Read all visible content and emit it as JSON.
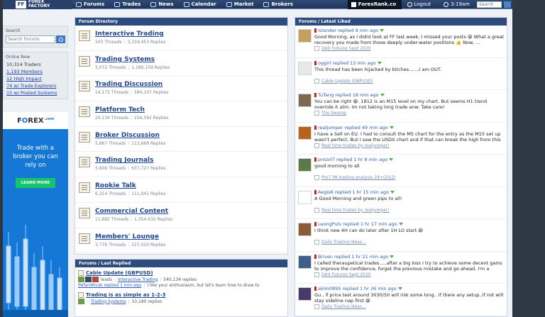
{
  "nav": {
    "logo_text": "FOREX FACTORY",
    "tabs": [
      "Forums",
      "Trades",
      "News",
      "Calendar",
      "Market",
      "Brokers"
    ],
    "forexrank": "ForexRank.co",
    "logout": "Logout",
    "time": "3:19am",
    "search_placeholder": "Search"
  },
  "sidebar": {
    "search_title": "Search",
    "search_placeholder": "Search Forums",
    "online_title": "Online Now",
    "online_items": [
      "10,314 Traders",
      "1,193 Members",
      "12 High Impact",
      "74 w/ Trade Explorers",
      "15 w/ Posted Systems"
    ],
    "ad": {
      "brand_a": "F",
      "brand_o": "O",
      "brand_b": "REX",
      "brand_dot": ".com",
      "text": "Trade with a broker you can rely on",
      "button": "LEARN MORE"
    }
  },
  "forum_directory": {
    "title": "Forum Directory",
    "forums": [
      {
        "name": "Interactive Trading",
        "threads": "503 Threads",
        "replies": "3,334,453 Replies"
      },
      {
        "name": "Trading Systems",
        "threads": "3,072 Threads",
        "replies": "1,186,159 Replies"
      },
      {
        "name": "Trading Discussion",
        "threads": "14,172 Threads",
        "replies": "584,107 Replies"
      },
      {
        "name": "Platform Tech",
        "threads": "20,134 Threads",
        "replies": "256,592 Replies"
      },
      {
        "name": "Broker Discussion",
        "threads": "5,867 Threads",
        "replies": "113,668 Replies"
      },
      {
        "name": "Trading Journals",
        "threads": "5,606 Threads",
        "replies": "637,727 Replies"
      },
      {
        "name": "Rookie Talk",
        "threads": "6,314 Threads",
        "replies": "111,041 Replies"
      },
      {
        "name": "Commercial Content",
        "threads": "11,682 Threads",
        "replies": "1,354,432 Replies"
      },
      {
        "name": "Members' Lounge",
        "threads": "3,776 Threads",
        "replies": "227,020 Replies"
      }
    ]
  },
  "last_replied": {
    "title": "Forums / Last Replied",
    "items": [
      {
        "title": "Cable Update (GBPUSD)",
        "forum": "Interactive Trading",
        "replies": "540,134 replies",
        "leads": "leads",
        "meta": "lfefan90csk replied 1 min ago",
        "snippet": "I like your enthusiasm, but let's learn how to draw to"
      },
      {
        "title": "Trading is as simple as 1-2-3",
        "forum": "Trading Systems",
        "replies": "10,180 replies"
      }
    ]
  },
  "latest_liked": {
    "title": "Forums / Latest Liked",
    "posts": [
      {
        "head": "Islander replied 9 min ago",
        "text": "Good Morning, as I didnt look at FF last week, I missed your posts 😀 What a great recovery you made from those deeply under-water positions 👍 Now, ...",
        "thread": "DAX Futures Sept 2020",
        "avatar": "#c4a05f"
      },
      {
        "head": "oggirl replied 13 min ago",
        "text": "This thread has been hijacked by bitches.......I am OUT.",
        "thread": "Cable Update (GBPUSD)",
        "avatar": "#e8e8e8"
      },
      {
        "head": "TuTang replied 18 min ago",
        "text": "You can be right 😀. 1812 is an M15 level on my chart. But seems H1 trend override it atm. Im not taking long trade anw. Take care!",
        "thread": "The Swamp",
        "avatar": "#7b6a4d"
      },
      {
        "head": "realjumper replied 49 min ago",
        "text": "I have a Sell on EU. I had to consult the M5 chart for the entry as the M15 set up wasn't perfect. But I saw the USDX chart and if that can break the high from this",
        "thread": "Real time trades by realjumper!",
        "avatar": "#b8621e"
      },
      {
        "head": "prozol7 replied 1 hr 8 min ago",
        "text": "good morning to all",
        "thread": "Pro7 PA trading analysis 28+GOLD",
        "avatar": "#5b7a4a"
      },
      {
        "head": "Aegis6 replied 1 hr 15 min ago",
        "text": "A Good Morning and green pips to all!",
        "thread": "Real time trades by realjumper!",
        "avatar": "#ffffff"
      },
      {
        "head": "LeongPulv replied 1 hr 17 min ago",
        "text": "I think new 4H can do later after 1H LO start.😀",
        "thread": "Daily Trading Ideas...",
        "avatar": "#8a5a3a"
      },
      {
        "head": "Briven replied 1 hr 21 min ago",
        "text": "I called theraupetical trades.....after a big loss I try to achieve some decent gains to improve the confidence, forget the previous mistake and go ahead. I'm a fighter",
        "thread": "DAX Futures Sept 2020",
        "avatar": "#3e5f8a"
      },
      {
        "head": "akim0895 replied 1 hr 26 min ago",
        "text": "Gu.. if price test around 3030/50 will risk some long.. if there any setup..if not will stay sideline nap first 😀",
        "thread": "Daily Trading Ideas...",
        "avatar": "#4a3a6a"
      }
    ]
  }
}
